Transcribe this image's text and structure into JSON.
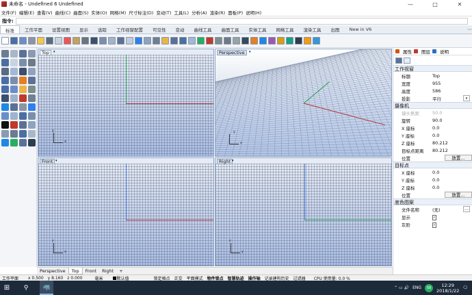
{
  "window": {
    "title": "未命名 - Undefined 6 Undefined",
    "min": "—",
    "max": "□",
    "close": "✕"
  },
  "menu": [
    "文件(F)",
    "编辑(E)",
    "查看(V)",
    "曲线(C)",
    "曲面(S)",
    "实体(O)",
    "网格(M)",
    "尺寸标注(D)",
    "变动(T)",
    "工具(L)",
    "分析(A)",
    "渲染(R)",
    "面板(P)",
    "说明(H)"
  ],
  "command": {
    "label": "指令:",
    "value": ""
  },
  "tabs": [
    "标准",
    "工作平面",
    "设置视图",
    "显示",
    "选取",
    "工作视窗配置",
    "可见性",
    "变动",
    "曲线工具",
    "曲面工具",
    "实体工具",
    "网格工具",
    "渲染工具",
    "出图",
    "New in V6"
  ],
  "active_tab": "标准",
  "toolbar_icon_colors": [
    "#ffffff",
    "#4a6fa5",
    "#6b8ec9",
    "#8b95a5",
    "#f2c94c",
    "#5a6b82",
    "#c9d3e0",
    "#eb5757",
    "#c4a35a",
    "#6c757d",
    "#3c4f6b",
    "#7a8fab",
    "#a0b4cc",
    "#5d7196",
    "#bfcbe0",
    "#2f80ed",
    "#8fa3c0",
    "#708090",
    "#e9b44c",
    "#5d7196",
    "#4a6fa5",
    "#a3b8d6",
    "#27ae60",
    "#c0392b",
    "#7f8c8d",
    "#6c7a89",
    "#95a5a6",
    "#34495e",
    "#e67e22",
    "#1e88e5",
    "#9b59b6",
    "#d4a017",
    "#16a085",
    "#2c3e50",
    "#f39c12",
    "#3498db"
  ],
  "left_tool_colors": [
    "#6b7c93",
    "#aab7c9",
    "#5d7196",
    "#8a9ab3",
    "#4a6fa5",
    "#c9d3e0",
    "#7a8fab",
    "#6c7a89",
    "#5a6b82",
    "#a3b8d6",
    "#3c4f6b",
    "#8fa3c0",
    "#4a6fa5",
    "#7a8fab",
    "#e67e22",
    "#5d7196",
    "#4a6fa5",
    "#6b8ec9",
    "#e9b44c",
    "#7f8c8d",
    "#3c4f6b",
    "#9fb1c9",
    "#c0392b",
    "#708090",
    "#1e88e5",
    "#5d7196",
    "#8b95a5",
    "#2f80ed",
    "#6b8ec9",
    "#a0b4cc",
    "#4a6fa5",
    "#7a8fab",
    "#111111",
    "#c0392b",
    "#5d7196",
    "#8fa3c0",
    "#8a9ab3",
    "#6b7c93",
    "#4a6fa5",
    "#aab7c9",
    "#1e88e5",
    "#27ae60",
    "#5d7196",
    "#2c3e50"
  ],
  "viewports": {
    "top": {
      "label": "Top",
      "axis_x": "x",
      "axis_y": "y"
    },
    "perspective": {
      "label": "Perspective",
      "axis_x": "x",
      "axis_y": "y"
    },
    "front": {
      "label": "Front",
      "axis_x": "x",
      "axis_y": "z"
    },
    "right": {
      "label": "Right",
      "axis_x": "y",
      "axis_y": "z"
    }
  },
  "viewport_tabs": [
    "Perspective",
    "Top",
    "Front",
    "Right"
  ],
  "active_viewport_tab": "Top",
  "viewport_tab_add": "+",
  "panel": {
    "tabs": [
      "属性",
      "图层",
      "说明"
    ],
    "tab_colors": [
      "#d35400",
      "#c0392b",
      "#2c6fbf"
    ],
    "sections": {
      "viewport": "工作视窗",
      "camera": "摄像机",
      "target": "目标点",
      "wallpaper": "底色图案"
    },
    "viewport_rows": [
      {
        "k": "标题",
        "v": "Top"
      },
      {
        "k": "宽度",
        "v": "955"
      },
      {
        "k": "高度",
        "v": "586"
      },
      {
        "k": "投影",
        "v": "平行"
      }
    ],
    "camera_rows": [
      {
        "k": "镜头焦距",
        "v": "50.0",
        "disabled": true
      },
      {
        "k": "旋转",
        "v": "90.0"
      },
      {
        "k": "X 座标",
        "v": "0.0"
      },
      {
        "k": "Y 座标",
        "v": "0.0"
      },
      {
        "k": "Z 座标",
        "v": "80.212"
      },
      {
        "k": "目标点距离",
        "v": "80.212"
      }
    ],
    "camera_position": {
      "k": "位置",
      "btn": "放置..."
    },
    "target_rows": [
      {
        "k": "X 座标",
        "v": "0.0"
      },
      {
        "k": "Y 座标",
        "v": "0.0"
      },
      {
        "k": "Z 座标",
        "v": "0.0"
      }
    ],
    "target_position": {
      "k": "位置",
      "btn": "放置..."
    },
    "wallpaper_rows": [
      {
        "k": "文件名称",
        "v": "(无)"
      },
      {
        "k": "显示",
        "v": "✓"
      },
      {
        "k": "灰阶",
        "v": "✓"
      }
    ]
  },
  "status": {
    "cplane": "工作平面",
    "x": "x 0.500",
    "y": "y 8.160",
    "z": "z 0.000",
    "unit": "毫米",
    "layer": "默认值",
    "toggles": [
      "锁定格点",
      "正交",
      "平面模式",
      "物件锁点",
      "智慧轨迹",
      "操作轴",
      "记录建构历史",
      "过滤器"
    ],
    "bold_toggles": [
      "物件锁点",
      "智慧轨迹",
      "操作轴"
    ],
    "cpu": "CPU 使用量: 0.0 %"
  },
  "taskbar": {
    "start": "⊞",
    "search": "⚲",
    "app": "🦏",
    "lang": "ENG",
    "badge": "58",
    "time": "12:29",
    "date": "2018/1/22",
    "notify": "🗨",
    "tray_icons": "⌃ ▭ 🔊"
  }
}
